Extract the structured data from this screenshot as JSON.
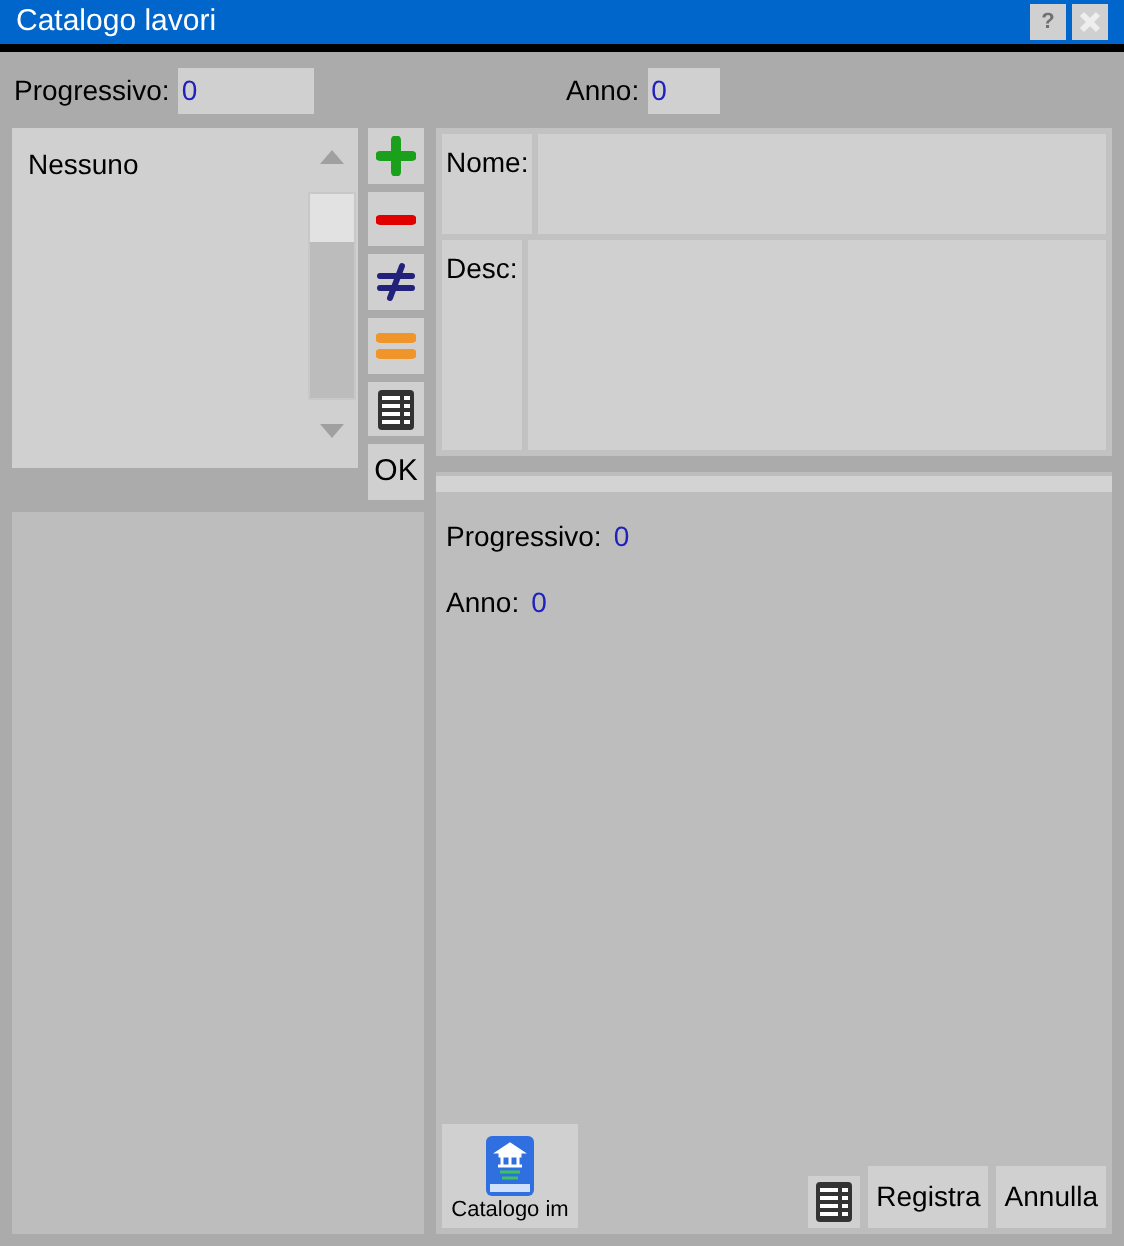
{
  "window": {
    "title": "Catalogo lavori",
    "buttons": [
      {
        "kind": "help",
        "label": "?"
      },
      {
        "kind": "close"
      }
    ]
  },
  "header": [
    {
      "label": "Progressivo:",
      "value": "0"
    },
    {
      "label": "Anno:",
      "value": "0"
    }
  ],
  "list": {
    "items": [
      {
        "label": "Nessuno"
      }
    ]
  },
  "toolbar": [
    {
      "kind": "add"
    },
    {
      "kind": "remove"
    },
    {
      "kind": "not-equal"
    },
    {
      "kind": "equal"
    },
    {
      "kind": "table"
    },
    {
      "kind": "text",
      "label": "OK"
    }
  ],
  "form": [
    {
      "label": "Nome:"
    },
    {
      "label": "Desc:"
    }
  ],
  "details": [
    {
      "label": "Progressivo:",
      "value": "0"
    },
    {
      "label": "Anno:",
      "value": "0"
    }
  ],
  "footer": {
    "catalog_button": "Catalogo im",
    "buttons": [
      {
        "label": "Registra"
      },
      {
        "label": "Annulla"
      }
    ]
  }
}
